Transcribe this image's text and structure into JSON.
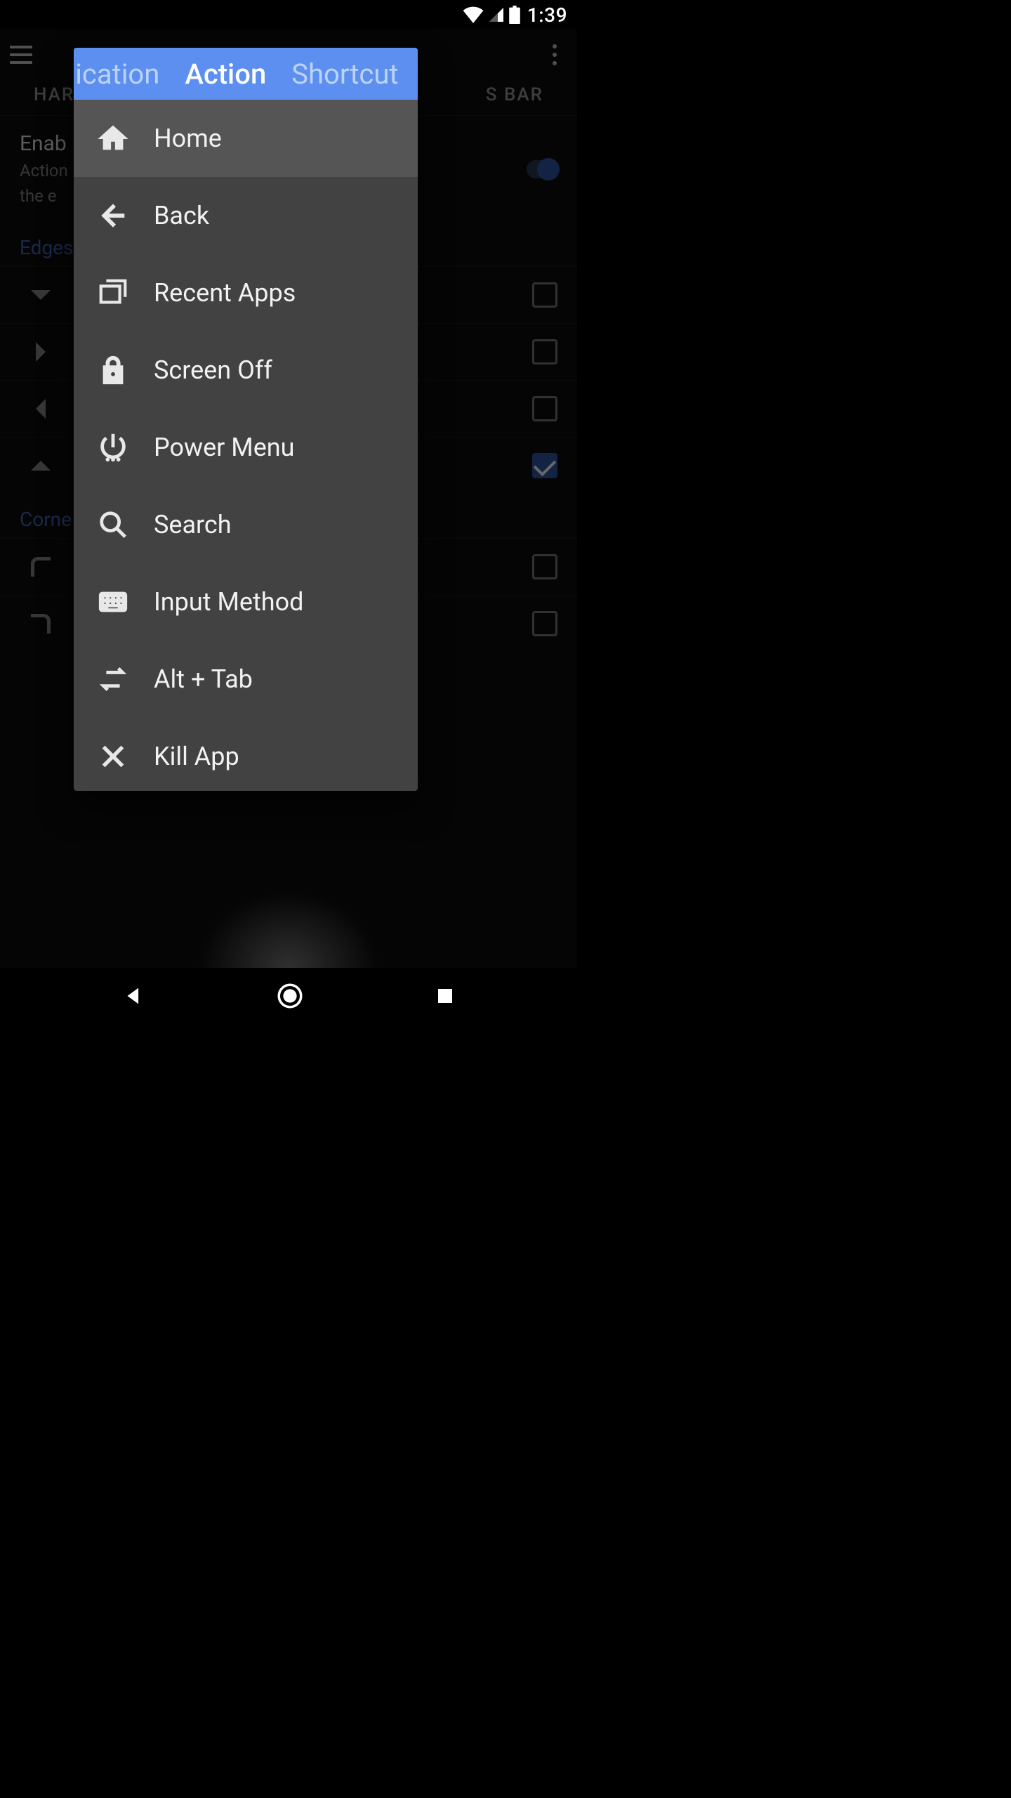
{
  "status": {
    "time": "1:39"
  },
  "background": {
    "tabs": {
      "left": "HAR",
      "right": "S BAR"
    },
    "enable": {
      "title": "Enab",
      "sub1": "Action",
      "sub2": "the e"
    },
    "sections": {
      "edges": "Edges",
      "corners": "Corne"
    }
  },
  "dialog": {
    "tabs": [
      {
        "id": "application",
        "label": "plication",
        "active": false
      },
      {
        "id": "action",
        "label": "Action",
        "active": true
      },
      {
        "id": "shortcut",
        "label": "Shortcut",
        "active": false
      }
    ],
    "actions": [
      {
        "id": "home",
        "label": "Home",
        "icon": "home-icon",
        "selected": true
      },
      {
        "id": "back",
        "label": "Back",
        "icon": "back-icon",
        "selected": false
      },
      {
        "id": "recent-apps",
        "label": "Recent Apps",
        "icon": "recents-icon",
        "selected": false
      },
      {
        "id": "screen-off",
        "label": "Screen Off",
        "icon": "lock-icon",
        "selected": false
      },
      {
        "id": "power-menu",
        "label": "Power Menu",
        "icon": "power-icon",
        "selected": false
      },
      {
        "id": "search",
        "label": "Search",
        "icon": "search-icon",
        "selected": false
      },
      {
        "id": "input-method",
        "label": "Input Method",
        "icon": "keyboard-icon",
        "selected": false
      },
      {
        "id": "alt-tab",
        "label": "Alt + Tab",
        "icon": "alt-tab-icon",
        "selected": false
      },
      {
        "id": "kill-app",
        "label": "Kill App",
        "icon": "close-icon",
        "selected": false
      }
    ]
  }
}
